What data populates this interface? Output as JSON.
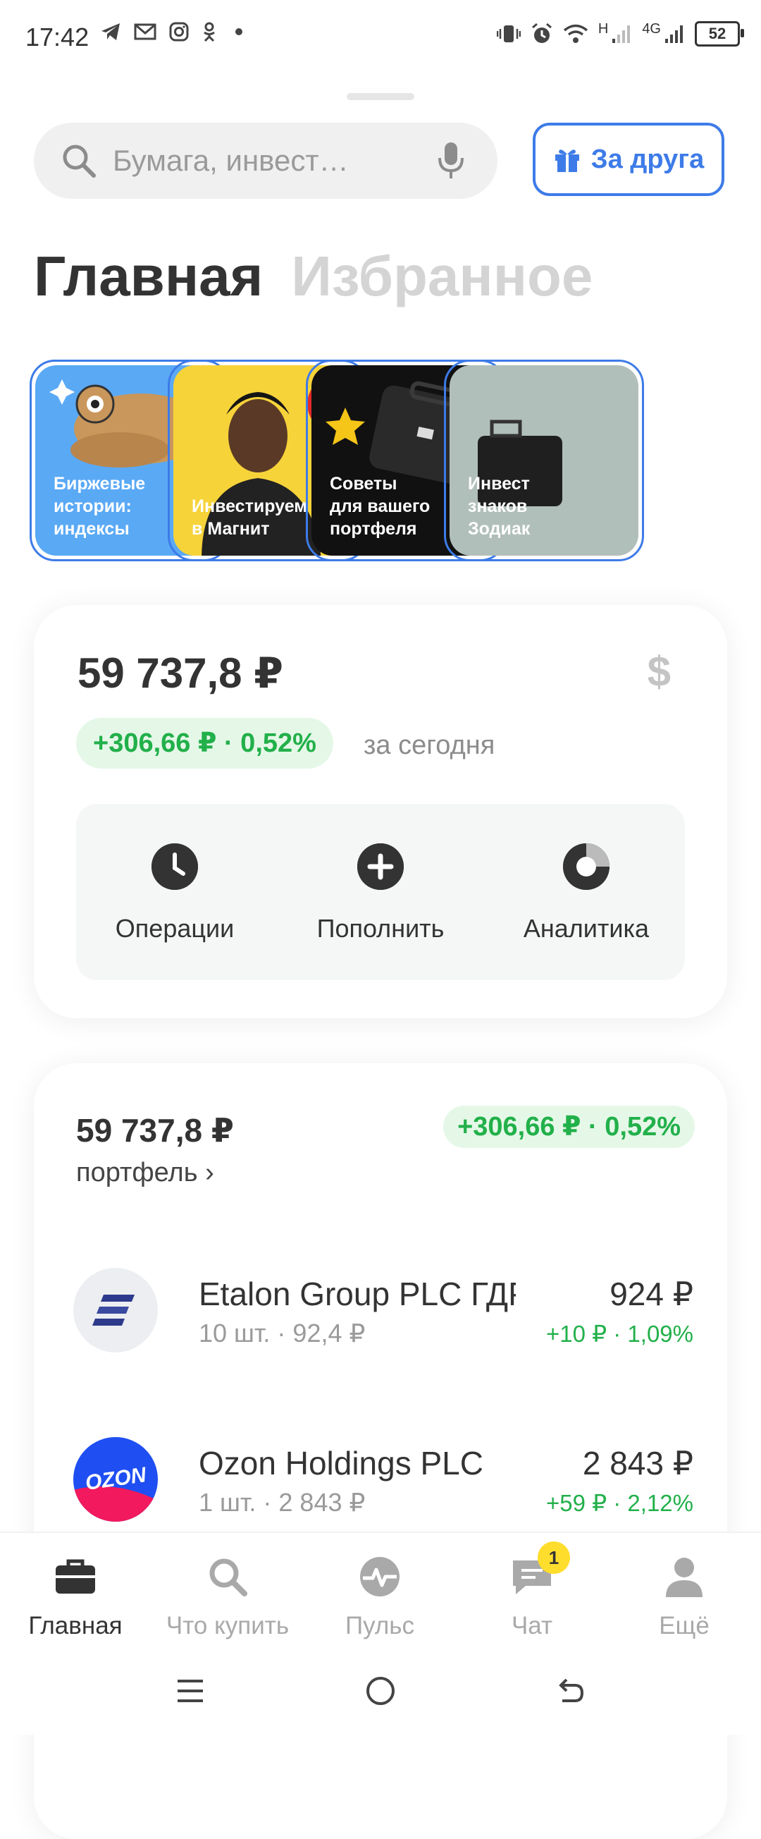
{
  "status_bar": {
    "time": "17:42",
    "network": "4G",
    "signal_label": "H",
    "battery": "52",
    "left_icons": [
      "telegram-icon",
      "gmail-icon",
      "instagram-icon",
      "odnoklassniki-icon",
      "dot-icon"
    ],
    "right_icons": [
      "vibrate-icon",
      "alarm-icon",
      "wifi-icon",
      "signal-icon",
      "signal-icon",
      "battery-icon"
    ]
  },
  "search": {
    "placeholder": "Бумага, инвест…",
    "icon": "search-icon",
    "voice_icon": "microphone-icon"
  },
  "referral_button": {
    "label": "За друга",
    "icon": "gift-icon",
    "color": "#3d7be8"
  },
  "tabs": [
    {
      "label": "Главная",
      "active": true
    },
    {
      "label": "Избранное",
      "active": false
    }
  ],
  "stories": [
    {
      "label": "Биржевые\nистории:\nиндексы",
      "bg": "#5aa9f5"
    },
    {
      "label": "Инвестируем\nв Магнит",
      "bg": "#f7d33a"
    },
    {
      "label": "Советы\nдля вашего\nпортфеля",
      "bg": "#111111"
    },
    {
      "label": "Инвест\nзнаков\nЗодиак",
      "bg": "#c9d4cf"
    }
  ],
  "summary": {
    "balance": "59 737,8 ₽",
    "currency_icon": "$",
    "change": "+306,66 ₽ · 0,52%",
    "period": "за сегодня",
    "actions": [
      {
        "label": "Операции",
        "icon": "clock-icon"
      },
      {
        "label": "Пополнить",
        "icon": "plus-icon"
      },
      {
        "label": "Аналитика",
        "icon": "pie-chart-icon"
      }
    ]
  },
  "portfolio": {
    "total": "59 737,8 ₽",
    "link": "портфель ›",
    "change": "+306,66 ₽ · 0,52%",
    "holdings": [
      {
        "name": "Etalon Group PLC ГДР",
        "qty": "10 шт. · 92,4 ₽",
        "price": "924 ₽",
        "change": "+10 ₽ · 1,09%",
        "logo": "etalon-logo"
      },
      {
        "name": "Ozon Holdings PLC",
        "qty": "1 шт. · 2 843 ₽",
        "price": "2 843 ₽",
        "change": "+59 ₽ · 2,12%",
        "logo": "ozon-logo",
        "logo_text": "OZON"
      }
    ]
  },
  "bottom_nav": [
    {
      "label": "Главная",
      "icon": "briefcase-icon",
      "active": true
    },
    {
      "label": "Что купить",
      "icon": "search-icon",
      "active": false
    },
    {
      "label": "Пульс",
      "icon": "pulse-icon",
      "active": false
    },
    {
      "label": "Чат",
      "icon": "chat-icon",
      "active": false,
      "badge": "1"
    },
    {
      "label": "Ещё",
      "icon": "profile-icon",
      "active": false
    }
  ],
  "colors": {
    "accent": "#3d7be8",
    "positive": "#22b04a",
    "positive_bg": "#e5f8e8",
    "badge": "#ffdd2d"
  }
}
